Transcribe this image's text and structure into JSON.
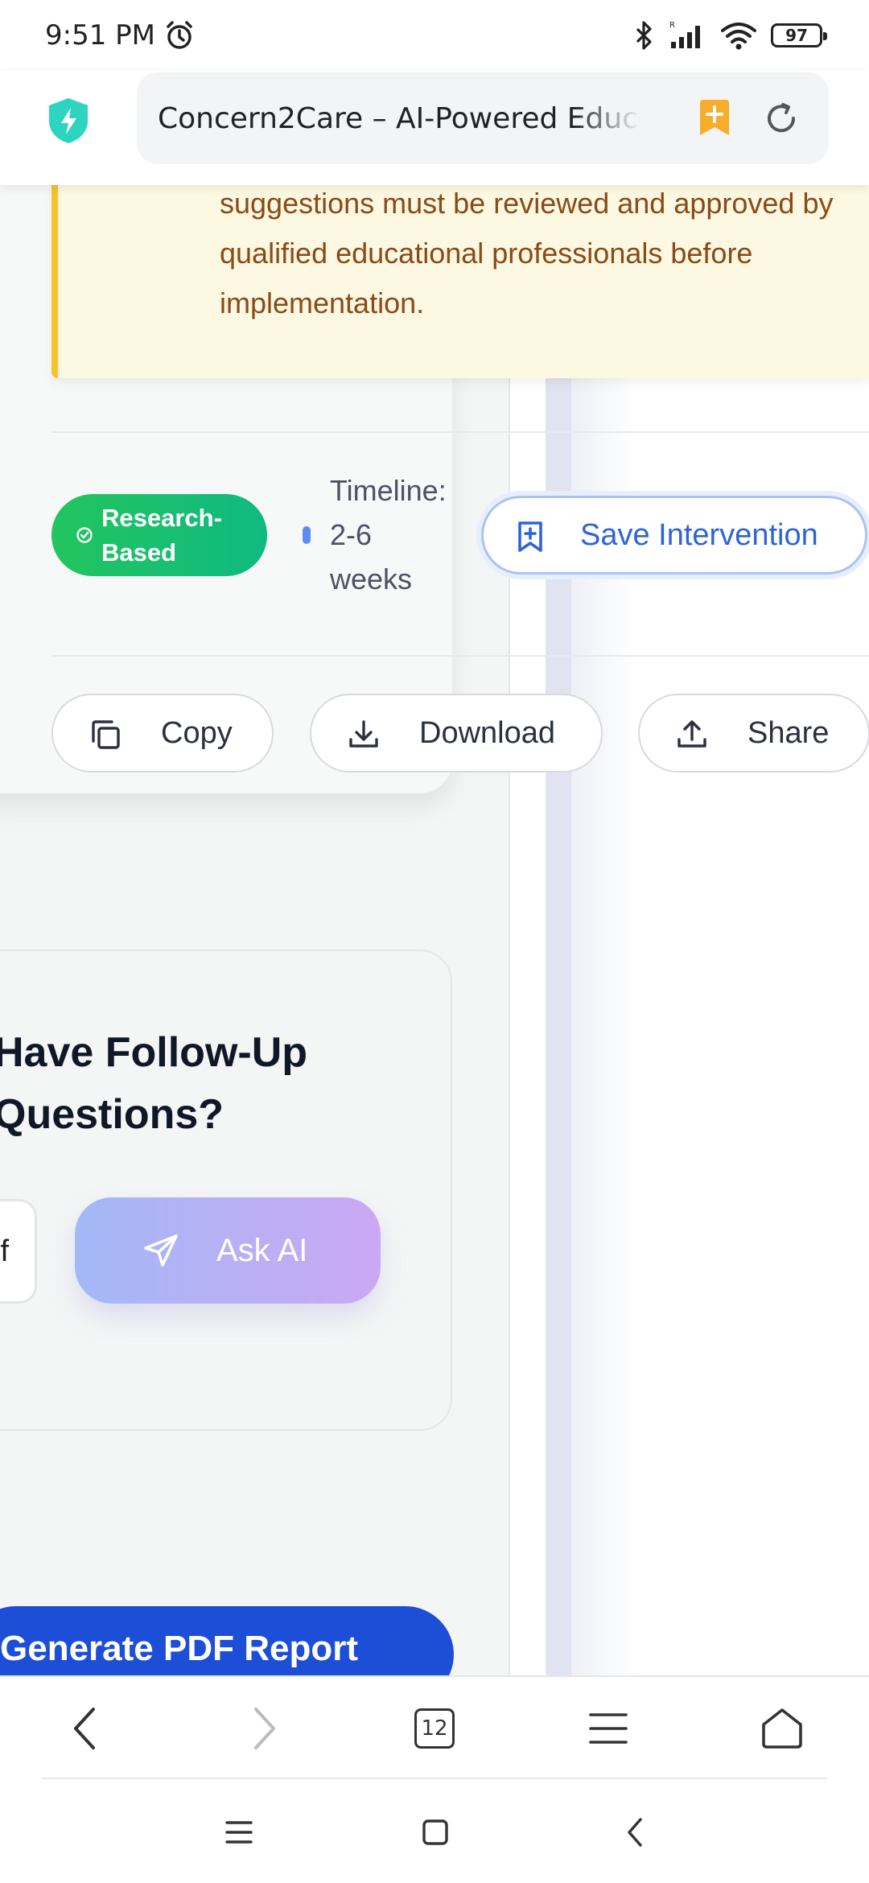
{
  "status_bar": {
    "time": "9:51 PM",
    "battery": "97",
    "icons": [
      "alarm-icon",
      "bluetooth-icon",
      "signal-icon",
      "wifi-icon",
      "battery-icon"
    ]
  },
  "browser": {
    "url_title": "Concern2Care – AI-Powered Educ",
    "tab_count": "12"
  },
  "notice": {
    "text": "suggestions must be reviewed and approved by qualified educational professionals before implementation."
  },
  "intervention": {
    "badge": "Research-Based",
    "timeline_label": "Timeline:",
    "timeline_value": "2-6 weeks",
    "save_label": "Save Intervention"
  },
  "actions": {
    "copy_label": "Copy",
    "download_label": "Download",
    "share_label": "Share"
  },
  "followup": {
    "title": "Have Follow-Up Questions?",
    "input_fragment": "f",
    "ask_label": "Ask AI"
  },
  "report": {
    "generate_label": "Generate PDF Report"
  },
  "colors": {
    "accent_blue": "#1d4ed8",
    "badge_green": "#22c55e",
    "notice_bg": "#fdf8e1",
    "notice_border": "#f6c22b",
    "notice_text": "#8a4a16",
    "save_blue": "#2f64d6"
  }
}
